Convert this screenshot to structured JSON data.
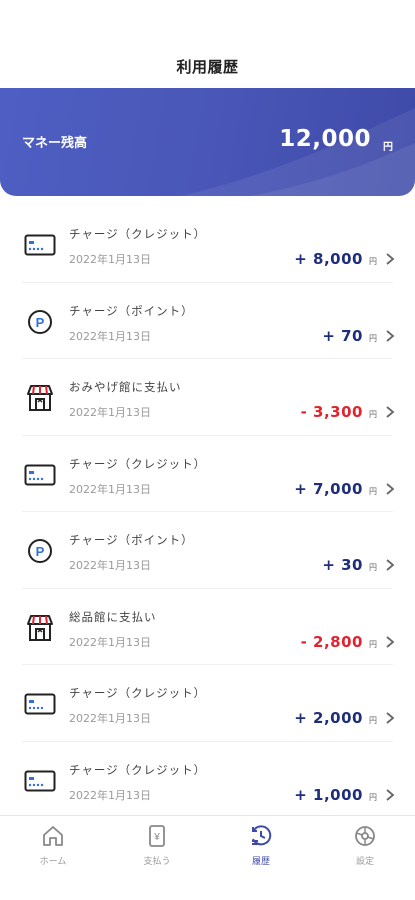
{
  "header": {
    "title": "利用履歴"
  },
  "balance": {
    "label": "マネー残高",
    "amount": "12,000",
    "unit": "円"
  },
  "colors": {
    "accent": "#3f4aa8",
    "positive": "#1f2e7a",
    "negative": "#e2232d"
  },
  "transactions": [
    {
      "icon": "credit-card-icon",
      "title": "チャージ（クレジット）",
      "date": "2022年1月13日",
      "amount": "+ 8,000",
      "unit": "円",
      "negative": false
    },
    {
      "icon": "point-icon",
      "title": "チャージ（ポイント）",
      "date": "2022年1月13日",
      "amount": "+ 70",
      "unit": "円",
      "negative": false
    },
    {
      "icon": "shop-icon",
      "title": "おみやげ館に支払い",
      "date": "2022年1月13日",
      "amount": "- 3,300",
      "unit": "円",
      "negative": true
    },
    {
      "icon": "credit-card-icon",
      "title": "チャージ（クレジット）",
      "date": "2022年1月13日",
      "amount": "+ 7,000",
      "unit": "円",
      "negative": false
    },
    {
      "icon": "point-icon",
      "title": "チャージ（ポイント）",
      "date": "2022年1月13日",
      "amount": "+ 30",
      "unit": "円",
      "negative": false
    },
    {
      "icon": "shop-icon",
      "title": "総品館に支払い",
      "date": "2022年1月13日",
      "amount": "- 2,800",
      "unit": "円",
      "negative": true
    },
    {
      "icon": "credit-card-icon",
      "title": "チャージ（クレジット）",
      "date": "2022年1月13日",
      "amount": "+ 2,000",
      "unit": "円",
      "negative": false
    },
    {
      "icon": "credit-card-icon",
      "title": "チャージ（クレジット）",
      "date": "2022年1月13日",
      "amount": "+ 1,000",
      "unit": "円",
      "negative": false
    }
  ],
  "tabs": [
    {
      "icon": "home-icon",
      "label": "ホーム",
      "active": false
    },
    {
      "icon": "payment-icon",
      "label": "支払う",
      "active": false
    },
    {
      "icon": "history-icon",
      "label": "履歴",
      "active": true
    },
    {
      "icon": "settings-icon",
      "label": "設定",
      "active": false
    }
  ]
}
